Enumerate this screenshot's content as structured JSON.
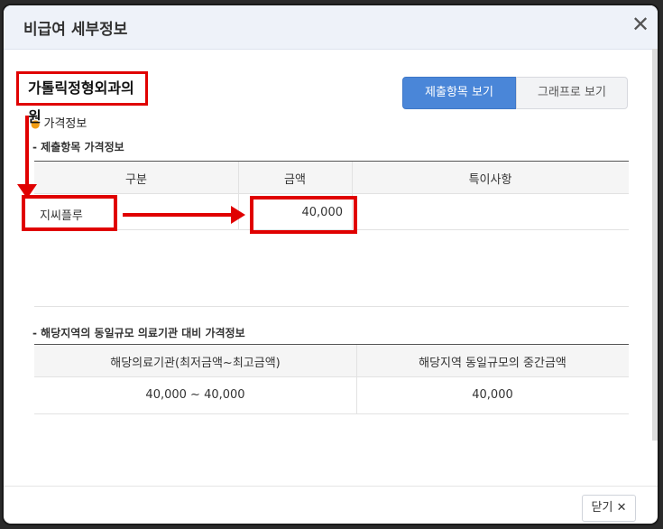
{
  "modal": {
    "title": "비급여 세부정보"
  },
  "hospital": {
    "name": "가톨릭정형외과의원"
  },
  "tabs": {
    "active": "제출항목 보기",
    "inactive": "그래프로 보기"
  },
  "section_price": {
    "label": "가격정보"
  },
  "table1": {
    "title": "- 제출항목 가격정보",
    "headers": [
      "구분",
      "금액",
      "특이사항"
    ],
    "rows": [
      {
        "item": "지씨플루",
        "amount": "40,000",
        "note": ""
      }
    ]
  },
  "table2": {
    "title": "- 해당지역의 동일규모 의료기관 대비 가격정보",
    "headers": [
      "해당의료기관(최저금액~최고금액)",
      "해당지역 동일규모의 중간금액"
    ],
    "rows": [
      {
        "range": "40,000 ~ 40,000",
        "median": "40,000"
      }
    ]
  },
  "footer": {
    "close_label": "닫기 ✕"
  },
  "colors": {
    "accent": "#4a86d8",
    "highlight": "#e00000",
    "bullet": "#f39c12"
  }
}
